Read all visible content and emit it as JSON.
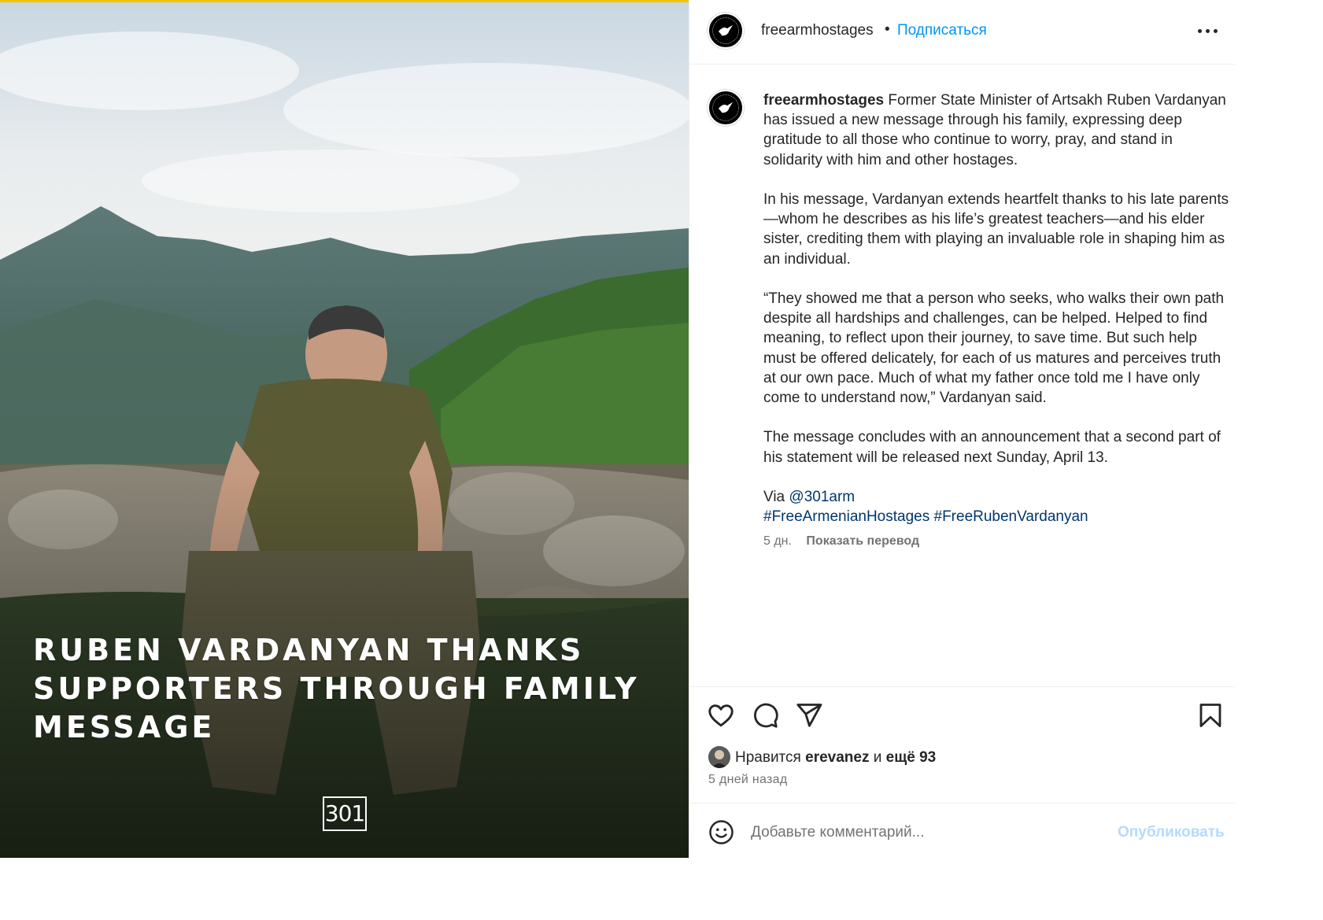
{
  "media": {
    "headline": "RUBEN VARDANYAN THANKS SUPPORTERS THROUGH FAMILY MESSAGE",
    "logo_text": "301",
    "accent_color": "#f2c300"
  },
  "header": {
    "username": "freearmhostages",
    "separator": "•",
    "follow_label": "Подписаться",
    "more_icon": "more-horizontal-icon"
  },
  "caption": {
    "username": "freearmhostages",
    "paragraphs": [
      "Former State Minister of Artsakh Ruben Vardanyan has issued a new message through his family, expressing deep gratitude to all those who continue to worry, pray, and stand in solidarity with him and other hostages.",
      "In his message, Vardanyan extends heartfelt thanks to his late parents—whom he describes as his life’s greatest teachers—and his elder sister, crediting them with playing an invaluable role in shaping him as an individual.",
      "“They showed me that a person who seeks, who walks their own path despite all hardships and challenges, can be helped. Helped to find meaning, to reflect upon their journey, to save time. But such help must be offered delicately, for each of us matures and perceives truth at our own pace. Much of what my father once told me I have only come to understand now,” Vardanyan said.",
      "The message concludes with an announcement that a second part of his statement will be released next Sunday, April 13."
    ],
    "via_label": "Via",
    "via_mention": "@301arm",
    "hashtag_1": "#FreeArmenianHostages",
    "hashtag_2": "#FreeRubenVardanyan",
    "time": "5 дн.",
    "translate_label": "Показать перевод"
  },
  "actions": {
    "like_icon": "heart-icon",
    "comment_icon": "comment-icon",
    "share_icon": "send-icon",
    "save_icon": "bookmark-icon"
  },
  "likes": {
    "prefix": "Нравится",
    "user": "erevanez",
    "conj": "и",
    "others": "ещё 93"
  },
  "posted_ago": "5 дней назад",
  "comment_box": {
    "placeholder": "Добавьте комментарий...",
    "post_label": "Опубликовать",
    "emoji_icon": "smiley-icon"
  },
  "colors": {
    "link_blue": "#0095f6",
    "hashtag_blue": "#00376b",
    "muted": "#737373",
    "post_disabled": "#b3dbff"
  }
}
